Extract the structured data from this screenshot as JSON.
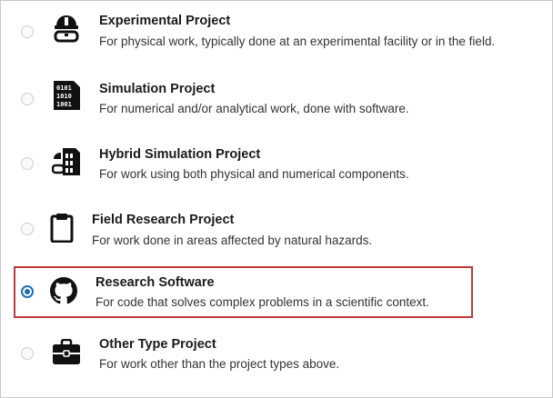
{
  "project_types": [
    {
      "id": "experimental",
      "title": "Experimental Project",
      "description": "For physical work, typically done at an experimental facility or in the field.",
      "icon": "hard-hat-goggles-icon",
      "selected": false
    },
    {
      "id": "simulation",
      "title": "Simulation Project",
      "description": "For numerical and/or analytical work, done with software.",
      "icon": "binary-code-icon",
      "selected": false
    },
    {
      "id": "hybrid",
      "title": "Hybrid Simulation Project",
      "description": "For work using both physical and numerical components.",
      "icon": "hybrid-simulation-icon",
      "selected": false
    },
    {
      "id": "field_research",
      "title": "Field Research Project",
      "description": "For work done in areas affected by natural hazards.",
      "icon": "clipboard-icon",
      "selected": false
    },
    {
      "id": "research_software",
      "title": "Research Software",
      "description": "For code that solves complex problems in a scientific context.",
      "icon": "github-icon",
      "selected": true
    },
    {
      "id": "other",
      "title": "Other Type Project",
      "description": "For work other than the project types above.",
      "icon": "briefcase-icon",
      "selected": false
    }
  ],
  "colors": {
    "selected_radio": "#1f6fb5",
    "highlight_border": "#c0393b"
  }
}
